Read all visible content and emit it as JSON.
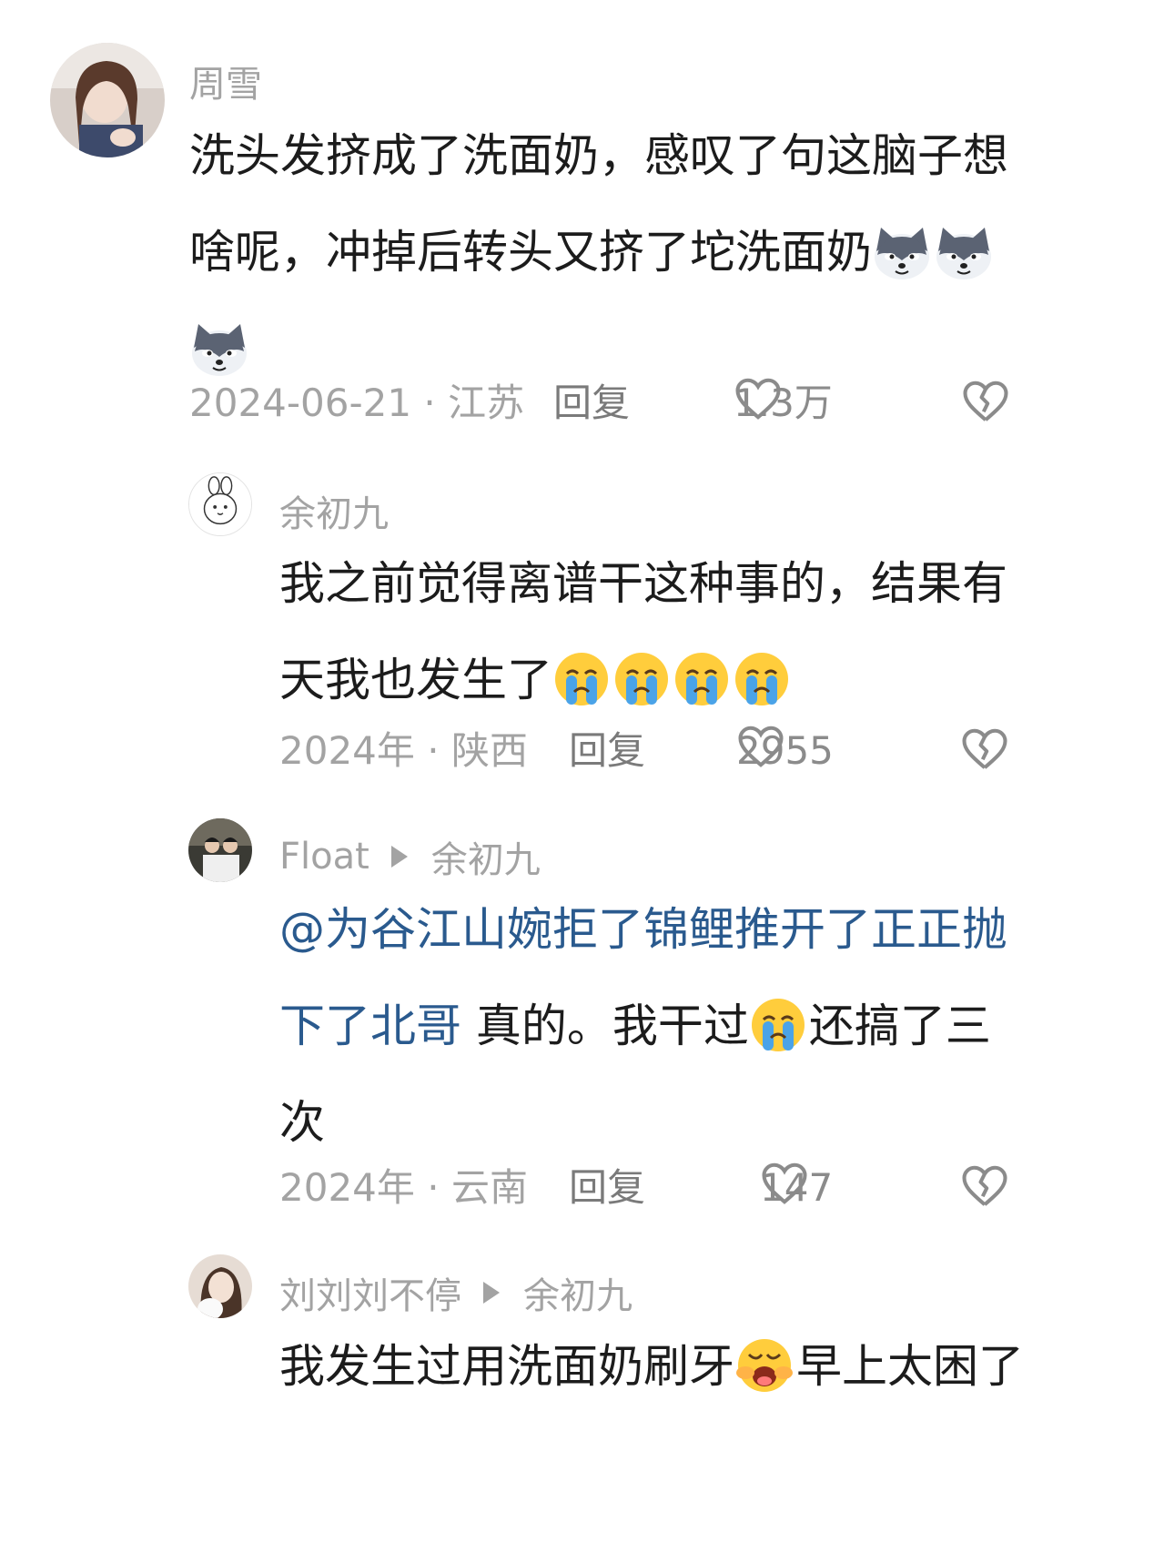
{
  "comments": [
    {
      "author": "周雪",
      "lines": [
        "洗头发挤成了洗面奶，感叹了句这脑子想",
        "啥呢，冲掉后转头又挤了坨洗面奶"
      ],
      "emoji": "husky-emoji",
      "date": "2024-06-21 · 江苏",
      "reply": "回复",
      "likes": "1.3万"
    },
    {
      "author": "余初九",
      "lines": [
        "我之前觉得离谱干这种事的，结果有",
        "天我也发生了"
      ],
      "emoji": "crying-face-emoji",
      "date": "2024年 · 陕西",
      "reply": "回复",
      "likes": "2955"
    },
    {
      "author": "Float",
      "reply_to": "余初九",
      "mention_line1": "@为谷江山婉拒了锦鲤推开了正正抛",
      "mention_line2": "下了北哥",
      "line2_rest_a": " 真的。我干过",
      "line2_rest_b": "还搞了三",
      "line3": "次",
      "emoji": "crying-face-emoji",
      "date": "2024年 · 云南",
      "reply": "回复",
      "likes": "147"
    },
    {
      "author": "刘刘刘不停",
      "reply_to": "余初九",
      "text_a": "我发生过用洗面奶刷牙",
      "text_b": "早上太困了",
      "emoji": "yawning-face-emoji"
    }
  ],
  "colors": {
    "meta": "#a3a3a3",
    "mention": "#2a5a8e",
    "text": "#1c1c1c"
  }
}
